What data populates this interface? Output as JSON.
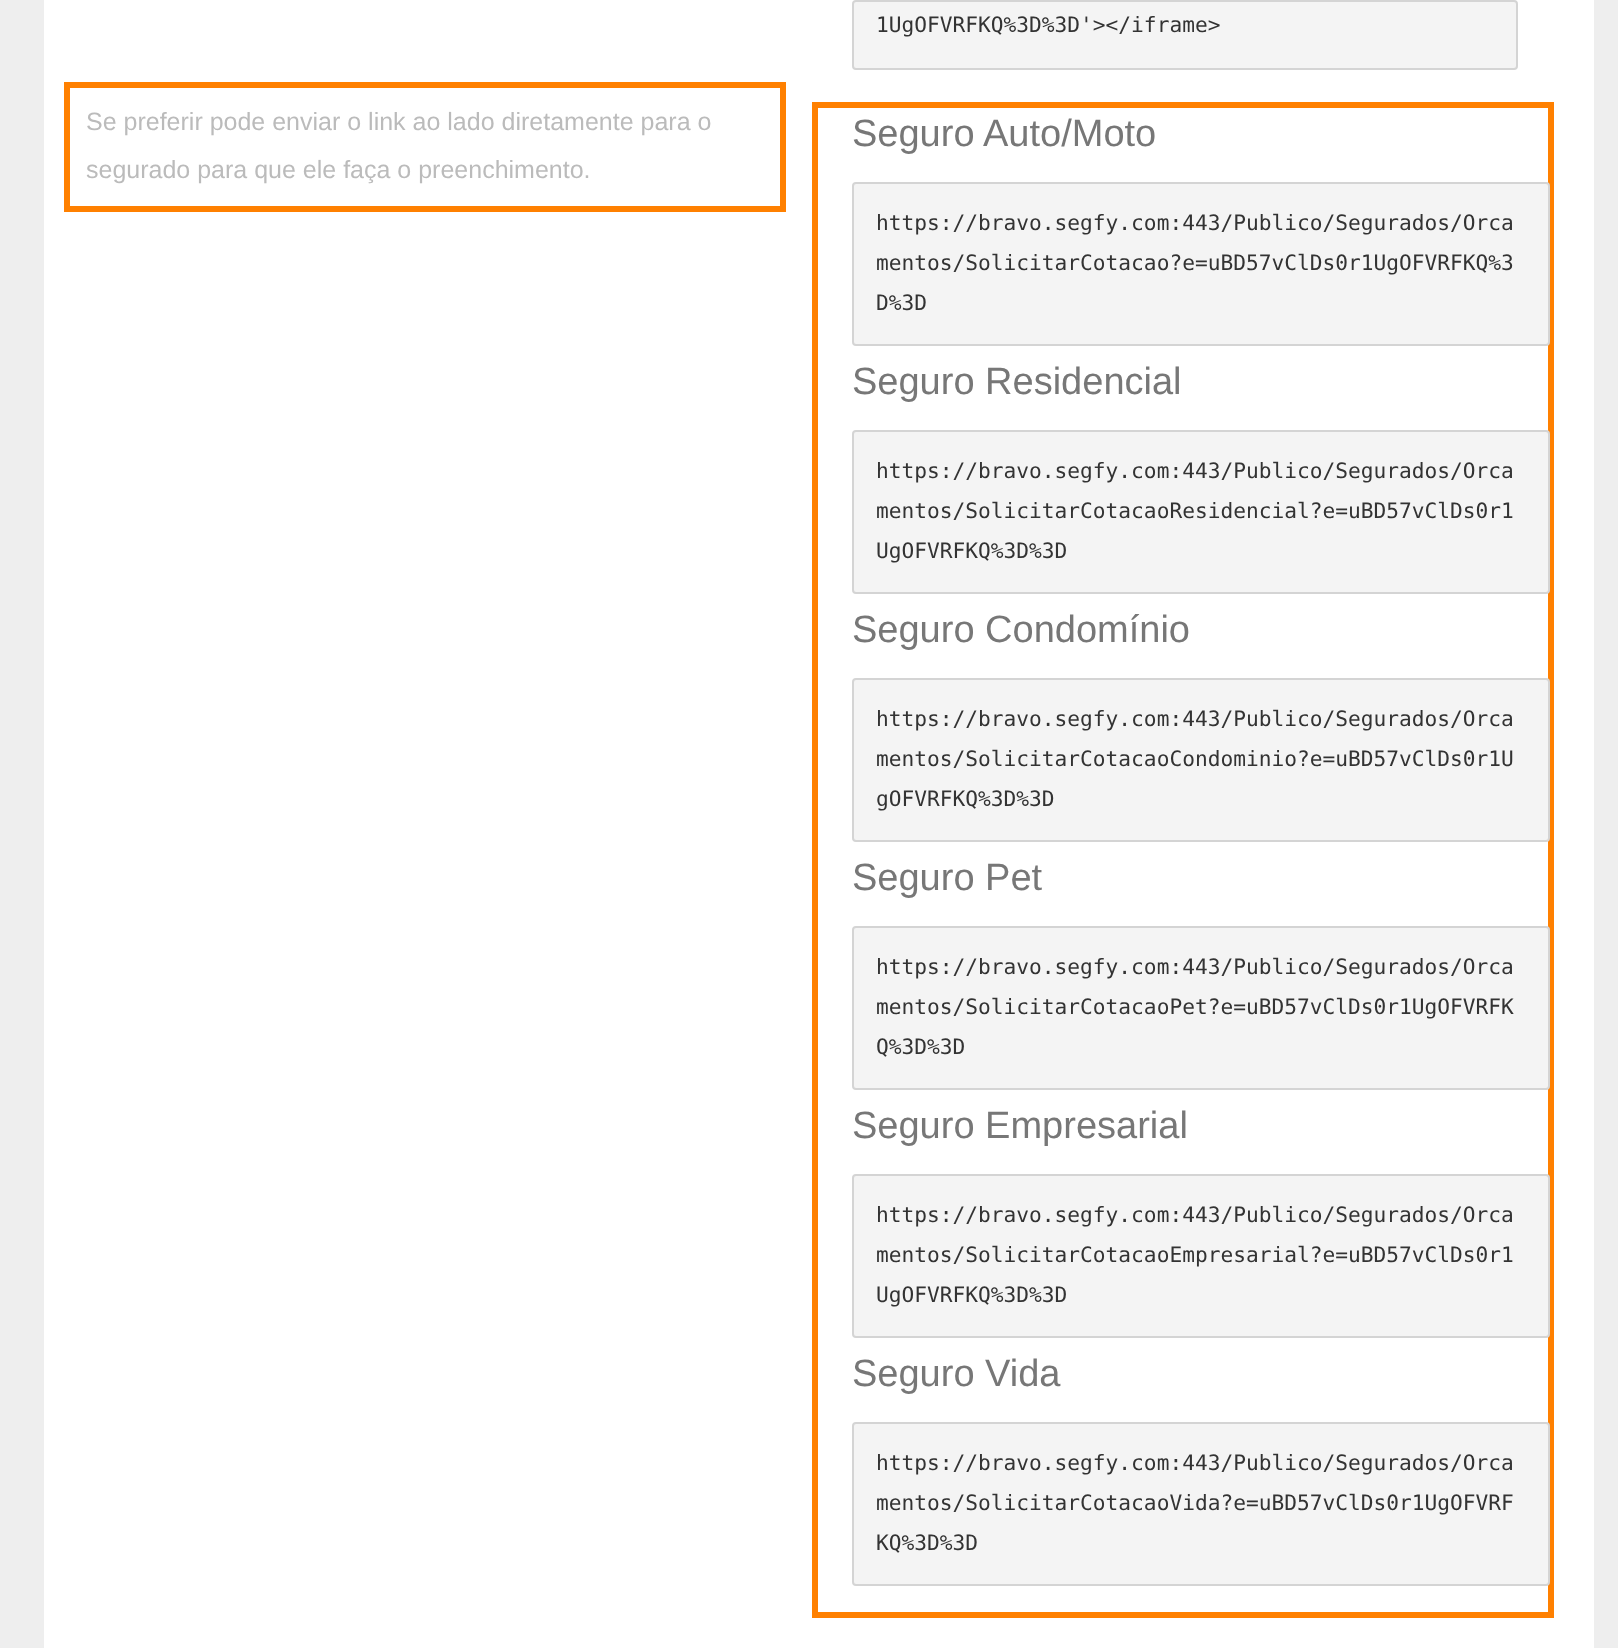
{
  "embed_code_tail": "1UgOFVRFKQ%3D%3D'></iframe>",
  "note": "Se preferir pode enviar o link ao lado diretamente para o segurado para que ele faça o preenchimento.",
  "links": [
    {
      "title": "Seguro Auto/Moto",
      "url": "https://bravo.segfy.com:443/Publico/Segurados/Orcamentos/SolicitarCotacao?e=uBD57vClDs0r1UgOFVRFKQ%3D%3D"
    },
    {
      "title": "Seguro Residencial",
      "url": "https://bravo.segfy.com:443/Publico/Segurados/Orcamentos/SolicitarCotacaoResidencial?e=uBD57vClDs0r1UgOFVRFKQ%3D%3D"
    },
    {
      "title": "Seguro Condomínio",
      "url": "https://bravo.segfy.com:443/Publico/Segurados/Orcamentos/SolicitarCotacaoCondominio?e=uBD57vClDs0r1UgOFVRFKQ%3D%3D"
    },
    {
      "title": "Seguro Pet",
      "url": "https://bravo.segfy.com:443/Publico/Segurados/Orcamentos/SolicitarCotacaoPet?e=uBD57vClDs0r1UgOFVRFKQ%3D%3D"
    },
    {
      "title": "Seguro Empresarial",
      "url": "https://bravo.segfy.com:443/Publico/Segurados/Orcamentos/SolicitarCotacaoEmpresarial?e=uBD57vClDs0r1UgOFVRFKQ%3D%3D"
    },
    {
      "title": "Seguro Vida",
      "url": "https://bravo.segfy.com:443/Publico/Segurados/Orcamentos/SolicitarCotacaoVida?e=uBD57vClDs0r1UgOFVRFKQ%3D%3D"
    }
  ]
}
